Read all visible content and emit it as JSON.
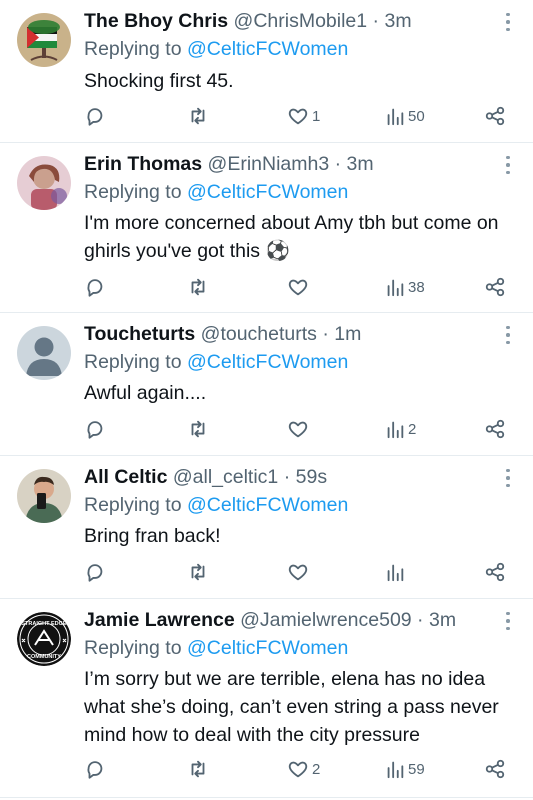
{
  "colors": {
    "text": "#0f1419",
    "muted": "#536471",
    "link": "#1d9bf0",
    "divider": "#e6ecf0"
  },
  "tweets": [
    {
      "name": "The Bhoy Chris",
      "handle": "@ChrisMobile1",
      "time": "3m",
      "reply_prefix": "Replying to ",
      "reply_to": "@CelticFCWomen",
      "text": "Shocking first 45.",
      "likes": "1",
      "views": "50",
      "avatar_icon": "palestine-flag-tree-avatar"
    },
    {
      "name": "Erin Thomas",
      "handle": "@ErinNiamh3",
      "time": "3m",
      "reply_prefix": "Replying to ",
      "reply_to": "@CelticFCWomen",
      "text": "I'm more concerned about Amy tbh but come on\nghirls you've got this ⚽",
      "likes": "",
      "views": "38",
      "avatar_icon": "photo-avatar"
    },
    {
      "name": "Toucheturts",
      "handle": "@toucheturts",
      "time": "1m",
      "reply_prefix": "Replying to ",
      "reply_to": "@CelticFCWomen",
      "text": "Awful again....",
      "likes": "",
      "views": "2",
      "avatar_icon": "default-avatar"
    },
    {
      "name": "All Celtic",
      "handle": "@all_celtic1",
      "time": "59s",
      "reply_prefix": "Replying to ",
      "reply_to": "@CelticFCWomen",
      "text": "Bring fran back!",
      "likes": "",
      "views": "",
      "avatar_icon": "selfie-avatar"
    },
    {
      "name": "Jamie Lawrence",
      "handle": "@Jamielwrence509",
      "time": "3m",
      "reply_prefix": "Replying to ",
      "reply_to": "@CelticFCWomen",
      "text": "I’m sorry but we are terrible, elena has no idea\nwhat she’s doing, can’t even string a pass never\nmind how to deal with the city pressure",
      "likes": "2",
      "views": "59",
      "avatar_icon": "straight-edge-community-logo",
      "avatar_logo_text": [
        "STRAIGHT EDGE",
        "COMMUNITY"
      ]
    }
  ]
}
